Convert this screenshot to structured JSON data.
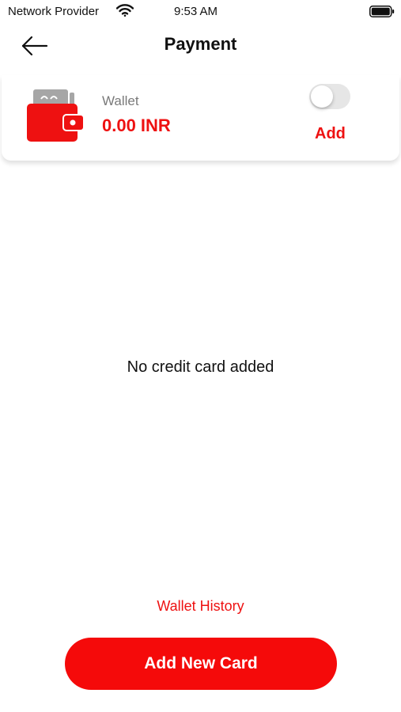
{
  "status_bar": {
    "carrier": "Network Provider",
    "time": "9:53 AM",
    "wifi_icon": "wifi-icon",
    "battery_icon": "battery-icon"
  },
  "nav": {
    "back_icon": "arrow-left-icon",
    "title": "Payment"
  },
  "wallet": {
    "icon": "wallet-icon",
    "label": "Wallet",
    "balance": "0.00 INR",
    "toggle_on": false,
    "add_label": "Add"
  },
  "empty_state": {
    "message": "No credit card added"
  },
  "footer": {
    "history_link": "Wallet History",
    "add_card_button": "Add New Card"
  },
  "colors": {
    "accent": "#ee1111",
    "button": "#f50a0a",
    "muted_text": "#7a7a7a",
    "toggle_off": "#e6e6e6"
  }
}
